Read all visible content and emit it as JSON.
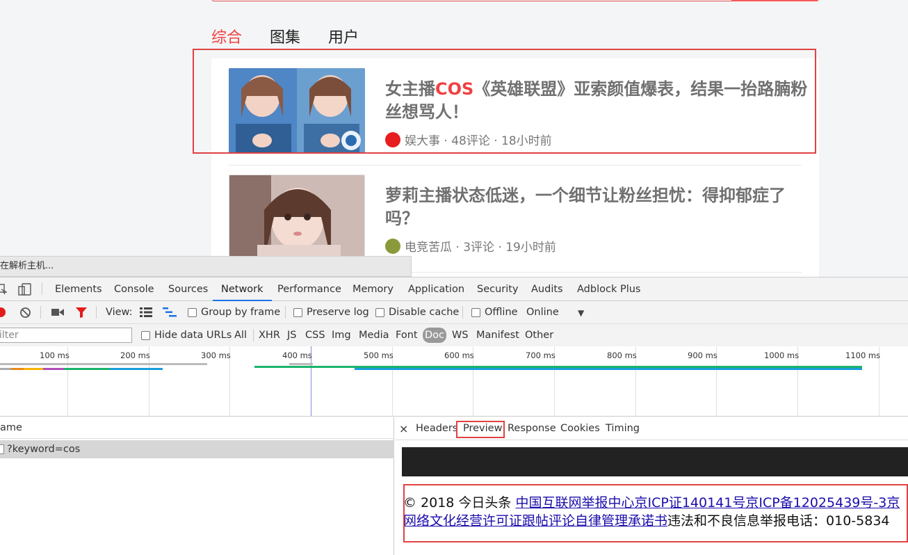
{
  "page": {
    "tabs": [
      {
        "label": "综合",
        "active": true
      },
      {
        "label": "图集",
        "active": false
      },
      {
        "label": "用户",
        "active": false
      }
    ],
    "results": [
      {
        "title_pre": "女主播",
        "title_highlight": "COS",
        "title_post": "《英雄联盟》亚索颜值爆表，结果一抬路腩粉丝想骂人！",
        "meta": "娱大事 · 48评论 · 18小时前"
      },
      {
        "title": "萝莉主播状态低迷，一个细节让粉丝担忧：得抑郁症了吗？",
        "meta": "电竞苦瓜 · 3评论 · 19小时前"
      }
    ],
    "status_text": "在解析主机..."
  },
  "devtools": {
    "tabs": [
      "Elements",
      "Console",
      "Sources",
      "Network",
      "Performance",
      "Memory",
      "Application",
      "Security",
      "Audits",
      "Adblock Plus"
    ],
    "active_tab": "Network",
    "toolbar": {
      "view_label": "View:",
      "group_by_frame": "Group by frame",
      "preserve_log": "Preserve log",
      "disable_cache": "Disable cache",
      "offline": "Offline",
      "throttle": "Online"
    },
    "filter": {
      "placeholder": "ilter",
      "hide_data_urls": "Hide data URLs",
      "types": [
        "All",
        "XHR",
        "JS",
        "CSS",
        "Img",
        "Media",
        "Font",
        "Doc",
        "WS",
        "Manifest",
        "Other"
      ],
      "active_type": "Doc"
    },
    "timeline_ticks": [
      "100 ms",
      "200 ms",
      "300 ms",
      "400 ms",
      "500 ms",
      "600 ms",
      "700 ms",
      "800 ms",
      "900 ms",
      "1000 ms",
      "1100 ms"
    ],
    "name_header": "ame",
    "request_name": "?keyword=cos",
    "detail_tabs": [
      "Headers",
      "Preview",
      "Response",
      "Cookies",
      "Timing"
    ],
    "active_detail_tab": "Preview",
    "preview": {
      "line1_prefix": "© 2018 今日头条 ",
      "line1_link": "中国互联网举报中心京ICP证140141号京ICP备12025439号-3京",
      "line2_link": "网络文化经营许可证跟帖评论自律管理承诺书",
      "line2_suffix": "违法和不良信息举报电话：010-5834"
    }
  },
  "colors": {
    "accent_red": "#f04142",
    "devtools_blue": "#1a73e8",
    "annotation_red": "#e04242"
  }
}
